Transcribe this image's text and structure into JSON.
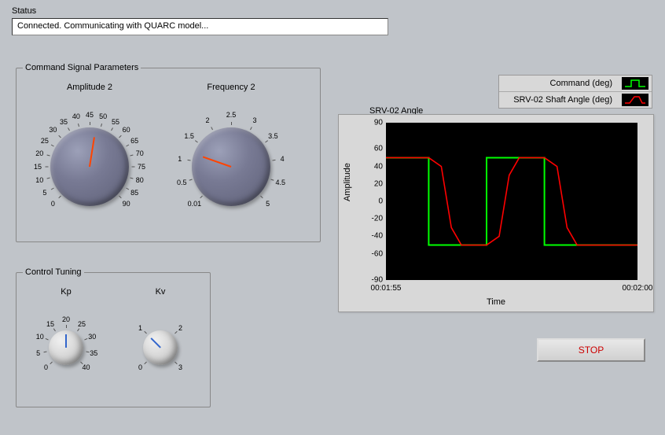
{
  "status": {
    "label": "Status",
    "text": "Connected. Communicating with QUARC model..."
  },
  "cmd_panel": {
    "title": "Command Signal Parameters",
    "amplitude": {
      "label": "Amplitude 2",
      "min": 0,
      "max": 90,
      "value": 48,
      "ticks": [
        "0",
        "5",
        "10",
        "15",
        "20",
        "25",
        "30",
        "35",
        "40",
        "45",
        "50",
        "55",
        "60",
        "65",
        "70",
        "75",
        "80",
        "85",
        "90"
      ]
    },
    "frequency": {
      "label": "Frequency 2",
      "min": 0.01,
      "max": 5,
      "value": 1.2,
      "ticks": [
        "0.01",
        "0.5",
        "1",
        "1.5",
        "2",
        "2.5",
        "3",
        "3.5",
        "4",
        "4.5",
        "5"
      ]
    }
  },
  "tuning_panel": {
    "title": "Control Tuning",
    "kp": {
      "label": "Kp",
      "min": 0,
      "max": 40,
      "value": 20,
      "ticks": [
        "0",
        "5",
        "10",
        "15",
        "20",
        "25",
        "30",
        "35",
        "40"
      ]
    },
    "kv": {
      "label": "Kv",
      "min": 0,
      "max": 3,
      "value": 1,
      "ticks": [
        "0",
        "1",
        "2",
        "3"
      ]
    }
  },
  "chart_panel": {
    "title": "SRV-02 Angle",
    "ylabel": "Amplitude",
    "xlabel": "Time",
    "legend": [
      {
        "name": "Command (deg)",
        "color": "#00ff00"
      },
      {
        "name": "SRV-02 Shaft Angle (deg)",
        "color": "#ff0000"
      }
    ],
    "yticks": [
      "90",
      "60",
      "40",
      "20",
      "0",
      "-20",
      "-40",
      "-60",
      "-90"
    ],
    "xticks": [
      "00:01:55",
      "00:02:00"
    ]
  },
  "stop_label": "STOP",
  "chart_data": {
    "type": "line",
    "title": "SRV-02 Angle",
    "xlabel": "Time",
    "ylabel": "Amplitude",
    "x_range": [
      "00:01:55",
      "00:02:00"
    ],
    "ylim": [
      -90,
      90
    ],
    "x": [
      0,
      0.07,
      0.13,
      0.24,
      0.29,
      0.38,
      0.43,
      0.55,
      0.6,
      0.74,
      0.79,
      1.0
    ],
    "series": [
      {
        "name": "Command (deg)",
        "color": "#00ff00",
        "values": [
          50,
          50,
          50,
          -50,
          -50,
          -50,
          50,
          50,
          50,
          -50,
          -50,
          -50
        ]
      },
      {
        "name": "SRV-02 Shaft Angle (deg)",
        "color": "#ff0000",
        "values": [
          50,
          50,
          50,
          45,
          -48,
          -50,
          -48,
          48,
          50,
          48,
          -48,
          -50
        ]
      }
    ],
    "note": "x expressed as fraction of window [00:01:55, 00:02:00]; square-wave command ±50°, response lags with overshoot-free slewing"
  }
}
